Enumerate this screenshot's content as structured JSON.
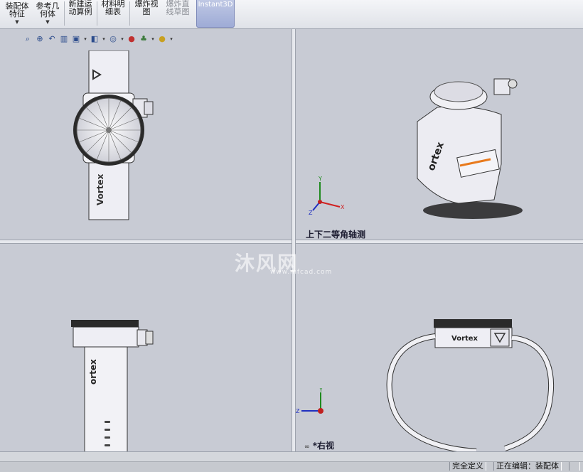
{
  "toolbar": {
    "buttons": [
      {
        "label": "装配体\n特征"
      },
      {
        "label": "参考几\n何体"
      },
      {
        "label": "新建运\n动算例"
      },
      {
        "label": "材料明\n细表"
      },
      {
        "label": "爆炸视\n图"
      },
      {
        "label": "爆炸直\n线草图"
      }
    ],
    "instant3d": "Instant3D"
  },
  "view_toolbar_icons": [
    "zoom-to-fit-icon",
    "zoom-to-area-icon",
    "previous-view-icon",
    "section-view-icon",
    "view-orientation-icon",
    "display-style-icon",
    "hide-show-icon",
    "edit-appearance-icon",
    "apply-scene-icon",
    "view-settings-icon"
  ],
  "views": {
    "iso_label": "上下二等角轴测",
    "right_label": "*右视"
  },
  "watermark": {
    "text": "沐风网",
    "url": "www.mfcad.com"
  },
  "model": {
    "brand": "ortex",
    "brand_full": "Vortex"
  },
  "triad": {
    "x": "X",
    "y": "Y",
    "z": "Z"
  },
  "statusbar": {
    "defined": "完全定义",
    "editing": "正在编辑：装配体"
  },
  "colors": {
    "accent": "#e87a1d",
    "triad_x": "#d02020",
    "triad_y": "#1f8a1f",
    "triad_z": "#2030c0"
  }
}
